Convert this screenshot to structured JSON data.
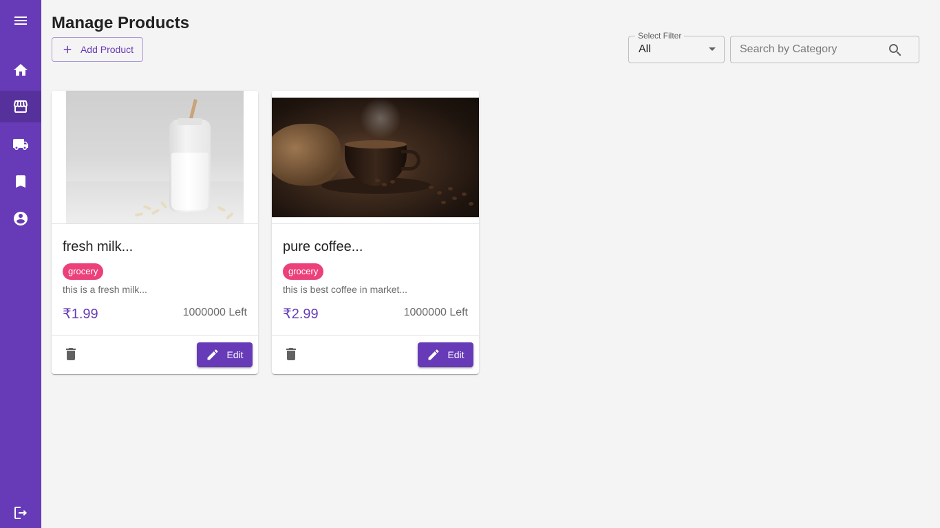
{
  "sidebar": {
    "items": [
      {
        "icon": "menu-icon"
      },
      {
        "icon": "home-icon"
      },
      {
        "icon": "storefront-icon",
        "active": true
      },
      {
        "icon": "truck-icon"
      },
      {
        "icon": "bookmark-icon"
      },
      {
        "icon": "account-circle-icon"
      },
      {
        "icon": "logout-icon"
      }
    ],
    "background": "#673ab7"
  },
  "header": {
    "title": "Manage Products",
    "add_label": "Add Product"
  },
  "filter": {
    "label": "Select Filter",
    "value": "All"
  },
  "search": {
    "placeholder": "Search by Category"
  },
  "products": [
    {
      "name": "fresh milk...",
      "category": "grocery",
      "description": "this is a fresh milk...",
      "price": "₹1.99",
      "stock": "1000000 Left",
      "edit_label": "Edit"
    },
    {
      "name": "pure coffee...",
      "category": "grocery",
      "description": "this is best coffee in market...",
      "price": "₹2.99",
      "stock": "1000000 Left",
      "edit_label": "Edit"
    }
  ],
  "colors": {
    "primary": "#673ab7",
    "chip": "#ec407a",
    "background": "#f4f4f4"
  }
}
